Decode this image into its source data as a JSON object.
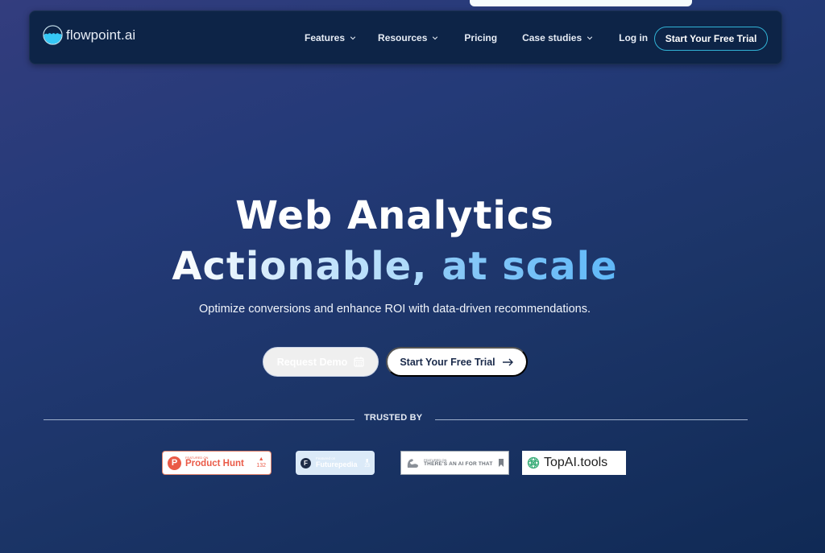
{
  "nav": {
    "logo_text": "flowpoint.ai",
    "items": [
      {
        "label": "Features",
        "has_dropdown": true
      },
      {
        "label": "Resources",
        "has_dropdown": true
      },
      {
        "label": "Pricing",
        "has_dropdown": false
      },
      {
        "label": "Case studies",
        "has_dropdown": true
      },
      {
        "label": "Log in",
        "has_dropdown": false
      }
    ],
    "cta_label": "Start Your Free Trial"
  },
  "hero": {
    "title_line1": "Web Analytics",
    "title_line2_part1": "Actionable,",
    "title_line2_part2": "at scale",
    "subtitle": "Optimize conversions and enhance ROI with data-driven recommendations.",
    "demo_button": "Request Demo",
    "trial_button": "Start Your Free Trial"
  },
  "trusted": {
    "label": "TRUSTED BY",
    "badges": {
      "product_hunt": {
        "small": "FEATURED ON",
        "name": "Product Hunt",
        "votes": "132"
      },
      "futurepedia": {
        "small": "Featured on",
        "name": "Futurepedia",
        "votes": "23"
      },
      "taaft": {
        "small": "FEATURED ON",
        "name": "THERE'S AN AI FOR THAT"
      },
      "topai": {
        "name": "TopAI.tools"
      }
    }
  },
  "colors": {
    "nav_bg": "#0d2447",
    "accent_cyan": "#31b3d6",
    "product_hunt": "#ea5a47",
    "title_blue": "#5fb8f8"
  }
}
